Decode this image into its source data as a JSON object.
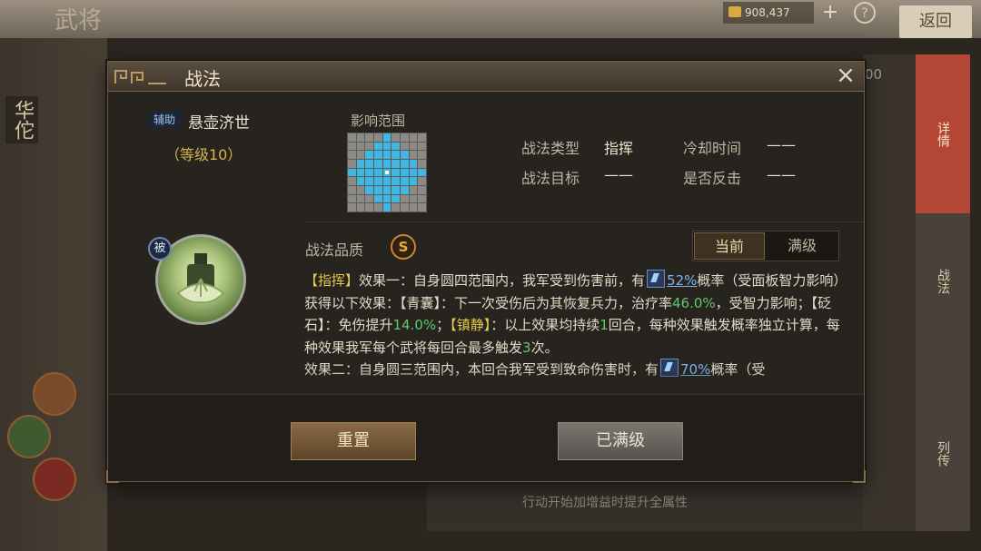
{
  "background": {
    "title": "武将",
    "currency": "908,437",
    "plus": "+",
    "help": "?",
    "back_button": "返回",
    "hero_name": "华佗",
    "counter": "00",
    "right_tabs": [
      "详情",
      "战法",
      "列传"
    ],
    "bottom_hint": "行动开始加增益时提升全属性"
  },
  "modal": {
    "title": "战法",
    "close": "×",
    "skill": {
      "type_badge": "辅助",
      "name": "悬壶济世",
      "level": "（等级10）",
      "passive_badge": "被"
    },
    "range_label": "影响范围",
    "attributes": {
      "type_label": "战法类型",
      "type_value": "指挥",
      "cooldown_label": "冷却时间",
      "cooldown_value": "——",
      "target_label": "战法目标",
      "target_value": "——",
      "counter_label": "是否反击",
      "counter_value": "——"
    },
    "quality_label": "战法品质",
    "quality_value": "S",
    "toggle": {
      "current": "当前",
      "max": "满级"
    },
    "description": {
      "p1_tag": "【指挥】",
      "p1_a": "效果一：自身圆四范围内，我军受到伤害前，有",
      "p1_pct": "52%",
      "p1_b": "概率（受面板智力影响）获得以下效果：【青囊】：下一次受伤后为其恢复兵力，治疗率",
      "p1_num1": "46.0%",
      "p1_c": "，受智力影响；【砭石】：免伤提升",
      "p1_num2": "14.0%",
      "p1_d": "；",
      "p1_tag2": "【镇静】",
      "p1_e": "：以上效果均持续",
      "p1_num3": "1",
      "p1_f": "回合，每种效果触发概率独立计算，每种效果我军每个武将每回合最多触发",
      "p1_num4": "3",
      "p1_g": "次。",
      "p2": "效果二：自身圆三范围内，本回合我军受到致命伤害时，有",
      "p2_pct": "70%",
      "p2_b": "概率（受"
    },
    "buttons": {
      "reset": "重置",
      "maxed": "已满级"
    }
  },
  "colors": {
    "accent_gold": "#d4b44e",
    "highlight_green": "#5fc96a",
    "highlight_yellow": "#e3c94d",
    "range_blue": "#3fb8e6",
    "quality_orange": "#e9a93d"
  },
  "range_pattern": [
    [
      0,
      0,
      0,
      0,
      1,
      0,
      0,
      0,
      0
    ],
    [
      0,
      0,
      0,
      1,
      1,
      1,
      0,
      0,
      0
    ],
    [
      0,
      0,
      1,
      1,
      1,
      1,
      1,
      0,
      0
    ],
    [
      0,
      1,
      1,
      1,
      1,
      1,
      1,
      1,
      0
    ],
    [
      1,
      1,
      1,
      1,
      2,
      1,
      1,
      1,
      1
    ],
    [
      0,
      1,
      1,
      1,
      1,
      1,
      1,
      1,
      0
    ],
    [
      0,
      0,
      1,
      1,
      1,
      1,
      1,
      0,
      0
    ],
    [
      0,
      0,
      0,
      1,
      1,
      1,
      0,
      0,
      0
    ],
    [
      0,
      0,
      0,
      0,
      1,
      0,
      0,
      0,
      0
    ]
  ]
}
